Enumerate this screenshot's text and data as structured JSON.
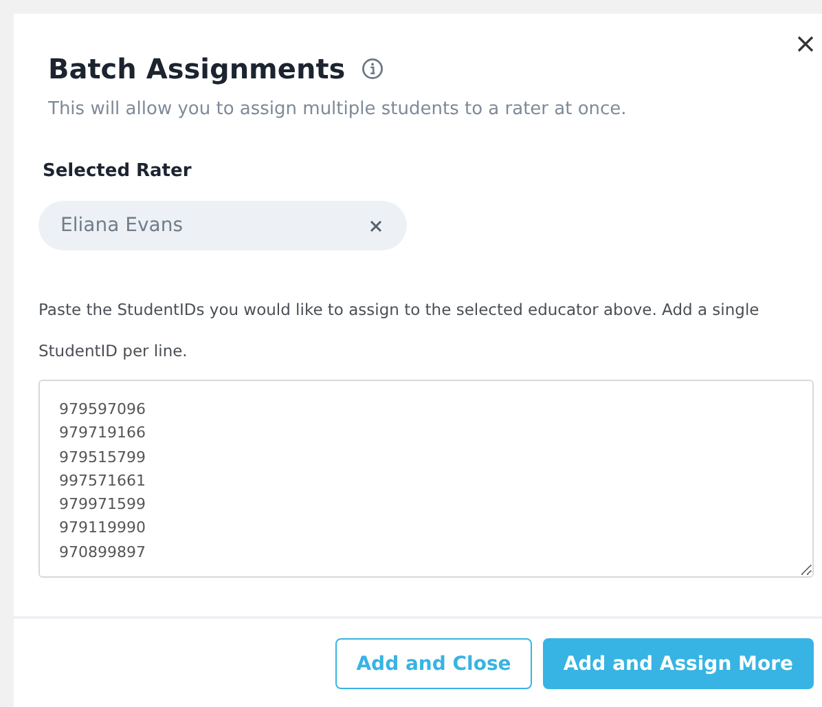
{
  "dialog": {
    "title": "Batch Assignments",
    "subtitle": "This will allow you to assign multiple students to a rater at once."
  },
  "selected_rater": {
    "label": "Selected Rater",
    "value": "Eliana Evans"
  },
  "instructions": "Paste the StudentIDs you would like to assign to the selected educator above. Add a single StudentID per line.",
  "student_ids": [
    "979597096",
    "979719166",
    "979515799",
    "997571661",
    "979971599",
    "979119990",
    "970899897"
  ],
  "buttons": [
    {
      "label": "Add and Close",
      "kind": "outline"
    },
    {
      "label": "Add and Assign More",
      "kind": "primary"
    }
  ]
}
